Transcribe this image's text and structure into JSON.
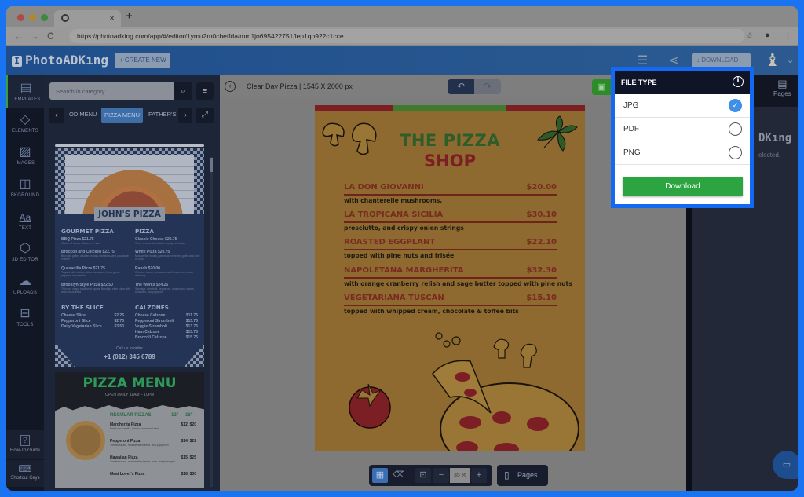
{
  "browser": {
    "url": "https://photoadking.com/app/#/editor/1ymu2m0cbeffda/mm1jo695422751/lep1qo922c1cce",
    "new_tab_label": "+",
    "close_tab_label": "×",
    "nav_back": "←",
    "nav_forward": "→",
    "reload": "C",
    "bookmark_icon": "☆",
    "profile_icon": "●",
    "menu_icon": "⋮"
  },
  "header": {
    "logo": "PhotoADKıng",
    "logo_mark": "I",
    "create_new": "+ CREATE NEW",
    "download": "↓ DOWNLOAD",
    "doc_icon": "☰",
    "share_icon": "⋖",
    "avatar_icon": "♝",
    "chevron": "⌄"
  },
  "rail": {
    "items": [
      {
        "label": "TEMPLATES",
        "icon": "▤"
      },
      {
        "label": "ELEMENTS",
        "icon": "◇"
      },
      {
        "label": "IMAGES",
        "icon": "▨"
      },
      {
        "label": "BKGROUND",
        "icon": "◫"
      },
      {
        "label": "TEXT",
        "icon": "Aa"
      },
      {
        "label": "3D EDITOR",
        "icon": "⬡"
      },
      {
        "label": "UPLOADS",
        "icon": "☁"
      },
      {
        "label": "TOOLS",
        "icon": "⊟"
      }
    ],
    "bottom": [
      {
        "label": "How-To Guide",
        "icon": "?"
      },
      {
        "label": "Shortcut Keys",
        "icon": "⌨"
      }
    ]
  },
  "panel": {
    "search_placeholder": "Search in category",
    "search_icon": "⌕",
    "list_icon": "≡",
    "prev": "‹",
    "next": "›",
    "expand_icon": "⤢",
    "categories": [
      "OD MENU",
      "PIZZA MENU",
      "FATHER'S"
    ],
    "active_category": "PIZZA MENU",
    "template1": {
      "title": "JOHN'S PIZZA",
      "gourmet_heading": "GOURMET PIZZA",
      "pizza_heading": "PIZZA",
      "gourmet": [
        {
          "name": "BBQ Pizza $21.75",
          "desc": "Choice of steak, chicken, or ham"
        },
        {
          "name": "Broccoli and Chicken $22.75",
          "desc": "Broccoli, grilled chicken, ricotta, tomatoes, and provolone cheese"
        },
        {
          "name": "Quesadilla Pizza $21.75",
          "desc": "Topped with chicken, diced tomatoes, fresh green peppers, mozzarella"
        },
        {
          "name": "Brooklyn-Style Pizza $22.50",
          "desc": "Thin and crispy traditional square Brooklyn style pizza with fresh mozzarella"
        }
      ],
      "pizza": [
        {
          "name": "Classic Cheese $20.75",
          "desc": "Three cheese blend with a zesty red sauce"
        },
        {
          "name": "White Pizza $20.75",
          "desc": "Mozzarella, ricotta, parmesan cheeses, garlic and olive oil crust"
        },
        {
          "name": "Ranch $20.00",
          "desc": "Chicken, bacon, tomatoes, and broccoli on ranch dressing"
        },
        {
          "name": "The Works $24.25",
          "desc": "Sausage, meatball, pepperoni, mushroom, onions, tomatoes, and peppers"
        }
      ],
      "slice_heading": "BY THE SLICE",
      "slices": [
        {
          "name": "Cheese Slice",
          "price": "$2.25"
        },
        {
          "name": "Pepperoni Slice",
          "price": "$2.75"
        },
        {
          "name": "Daily Vegetarian Slice",
          "price": "$3.50"
        }
      ],
      "calzones_heading": "CALZONES",
      "calzones": [
        {
          "name": "Cheese Calzone",
          "price": "$11.75"
        },
        {
          "name": "Pepperoni Stromboli",
          "price": "$15.75"
        },
        {
          "name": "Veggie Stromboli",
          "price": "$13.75"
        },
        {
          "name": "Ham Calzone",
          "price": "$15.75"
        },
        {
          "name": "Broccoli Calzone",
          "price": "$15.75"
        }
      ],
      "call": "Call us to order",
      "phone": "+1 (012) 345 6789"
    },
    "template2": {
      "title": "PIZZA MENU",
      "subtitle": "OPEN DAILY 11AM – 10PM",
      "section": "REGULAR PIZZAS",
      "size1": "12\"",
      "size2": "16\"",
      "items": [
        {
          "name": "Margherita Pizza",
          "desc": "Fresh mozzarella, tomato sauce and basil",
          "p1": "$12",
          "p2": "$20"
        },
        {
          "name": "Pepperoni Pizza",
          "desc": "Tomato sauce, mozzarella cheese, and pepperoni",
          "p1": "$14",
          "p2": "$22"
        },
        {
          "name": "Hawaiian Pizza",
          "desc": "Tomato sauce, mozzarella cheese, ham, and pineapple",
          "p1": "$15",
          "p2": "$25"
        },
        {
          "name": "Meat Lover's Pizza",
          "desc": "",
          "p1": "$18",
          "p2": "$30"
        }
      ]
    }
  },
  "canvas": {
    "back_icon": "‹",
    "doc_title": "Clear Day Pizza | 1545 X 2000 px",
    "undo_icon": "↶",
    "redo_icon": "↷",
    "save_icon": "▣",
    "poster": {
      "title_line1": "THE PIZZA",
      "title_line2": "SHOP",
      "stripe_colors": [
        "#7c1f24",
        "#3f7a2e",
        "#7c1f24"
      ],
      "items": [
        {
          "name": "LA DON GIOVANNI",
          "price": "$20.00",
          "desc": "with chanterelle mushrooms,"
        },
        {
          "name": "LA TROPICANA SICILIA",
          "price": "$30.10",
          "desc": "prosciutto, and crispy onion strings"
        },
        {
          "name": "ROASTED EGGPLANT",
          "price": "$22.10",
          "desc": "topped with pine nuts and frisée"
        },
        {
          "name": "NAPOLETANA MARGHERITA",
          "price": "$32.30",
          "desc": "with orange cranberry relish and sage butter topped with pine nuts"
        },
        {
          "name": "VEGETARIANA TUSCAN",
          "price": "$15.10",
          "desc": "topped with whipped cream, chocolate & toffee bits"
        }
      ]
    },
    "bottom_toolbar": {
      "grid_icon": "▦",
      "eraser_icon": "⌫",
      "present_icon": "⊡",
      "minus": "−",
      "zoom": "35 %",
      "plus": "+",
      "pages_label": "Pages",
      "pages_icon": "▯"
    }
  },
  "right_panel": {
    "pages_tab": "Pages",
    "pages_icon": "▤",
    "title_partial": "DKıng",
    "subtitle_partial": "elected.",
    "chat_icon": "▭"
  },
  "file_type_dialog": {
    "title": "FILE TYPE",
    "info_icon": "i",
    "options": [
      {
        "label": "JPG",
        "selected": true
      },
      {
        "label": "PDF",
        "selected": false
      },
      {
        "label": "PNG",
        "selected": false
      }
    ],
    "check_icon": "✓",
    "download_button": "Download",
    "highlight_color": "#1469f2",
    "download_color": "#2ca541"
  }
}
